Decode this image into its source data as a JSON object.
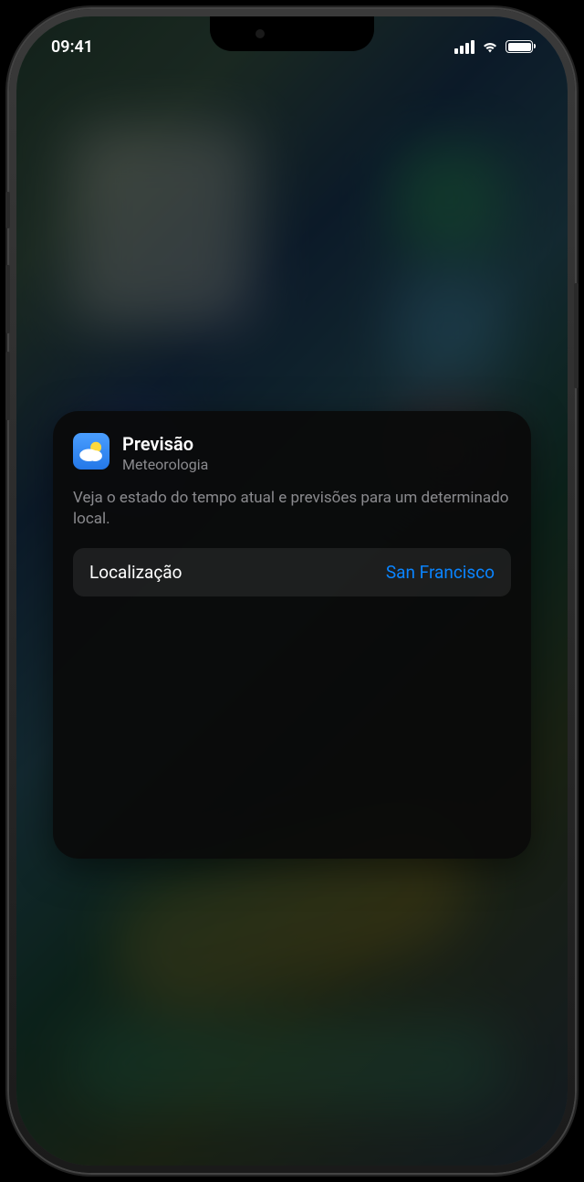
{
  "status_bar": {
    "time": "09:41"
  },
  "widget_card": {
    "title": "Previsão",
    "subtitle": "Meteorologia",
    "description": "Veja o estado do tempo atual e previsões para um determinado local.",
    "setting": {
      "label": "Localização",
      "value": "San Francisco"
    }
  }
}
